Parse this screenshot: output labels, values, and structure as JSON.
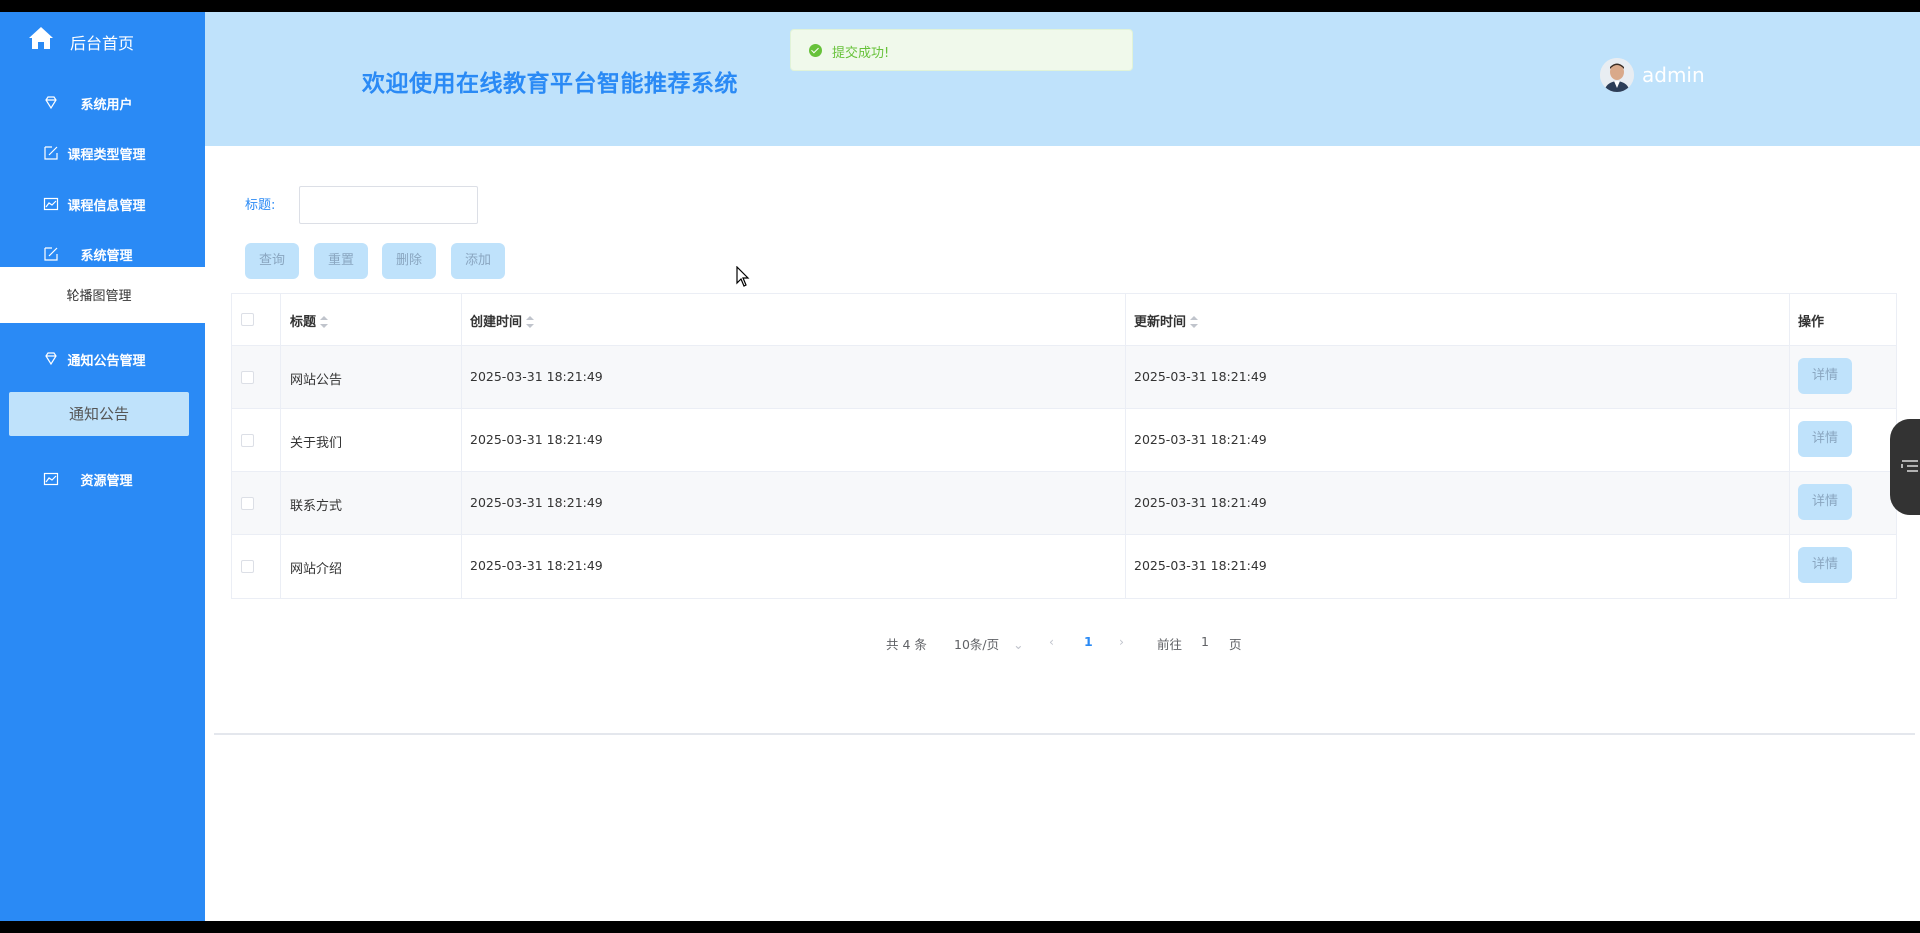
{
  "sidebar": {
    "home_label": "后台首页",
    "items": [
      {
        "label": "系统用户",
        "icon": "diamond-icon"
      },
      {
        "label": "课程类型管理",
        "icon": "edit-icon"
      },
      {
        "label": "课程信息管理",
        "icon": "chart-icon"
      },
      {
        "label": "系统管理",
        "icon": "edit-icon"
      },
      {
        "label": "轮播图管理"
      },
      {
        "label": "通知公告管理",
        "icon": "diamond-icon"
      },
      {
        "label": "通知公告"
      },
      {
        "label": "资源管理",
        "icon": "chart-icon"
      }
    ]
  },
  "header": {
    "welcome": "欢迎使用在线教育平台智能推荐系统",
    "username": "admin"
  },
  "toast": {
    "message": "提交成功!"
  },
  "search": {
    "label": "标题:",
    "value": ""
  },
  "buttons": {
    "query": "查询",
    "reset": "重置",
    "delete": "删除",
    "add": "添加"
  },
  "table": {
    "headers": {
      "title": "标题",
      "created": "创建时间",
      "updated": "更新时间",
      "actions": "操作"
    },
    "detail_label": "详情",
    "rows": [
      {
        "title": "网站公告",
        "created": "2025-03-31 18:21:49",
        "updated": "2025-03-31 18:21:49"
      },
      {
        "title": "关于我们",
        "created": "2025-03-31 18:21:49",
        "updated": "2025-03-31 18:21:49"
      },
      {
        "title": "联系方式",
        "created": "2025-03-31 18:21:49",
        "updated": "2025-03-31 18:21:49"
      },
      {
        "title": "网站介绍",
        "created": "2025-03-31 18:21:49",
        "updated": "2025-03-31 18:21:49"
      }
    ]
  },
  "pagination": {
    "total": "共 4 条",
    "page_size": "10条/页",
    "current": "1",
    "goto_prefix": "前往",
    "goto_value": "1",
    "goto_suffix": "页"
  },
  "colors": {
    "sidebar": "#2a8af5",
    "header": "#bfe2fb",
    "accent": "#2a8af5",
    "success": "#67c23a"
  }
}
